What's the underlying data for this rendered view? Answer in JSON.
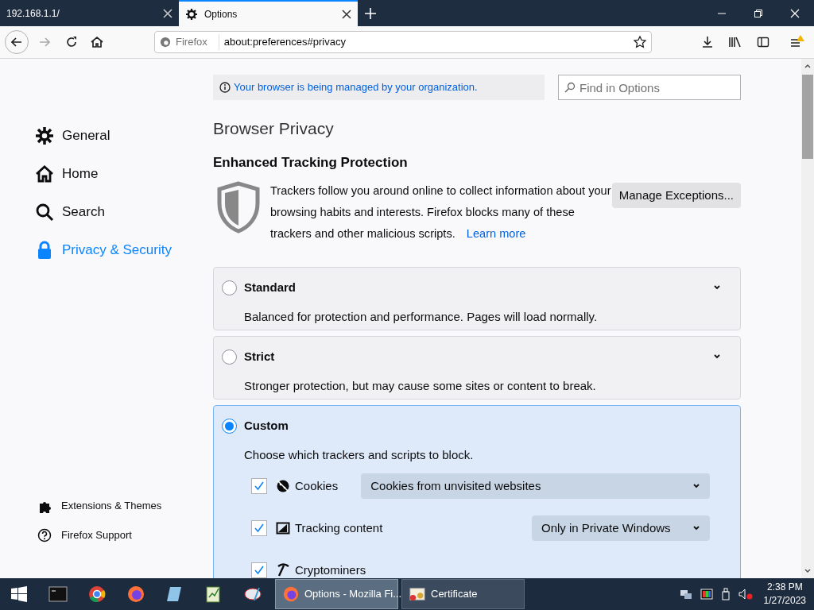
{
  "tabs": [
    {
      "label": "192.168.1.1/",
      "selected": false
    },
    {
      "label": "Options",
      "selected": true
    }
  ],
  "navbar": {
    "identity": "Firefox",
    "url": "about:preferences#privacy"
  },
  "sidebar": {
    "items": [
      {
        "label": "General",
        "selected": false
      },
      {
        "label": "Home",
        "selected": false
      },
      {
        "label": "Search",
        "selected": false
      },
      {
        "label": "Privacy & Security",
        "selected": true
      }
    ],
    "footer_links": [
      {
        "label": "Extensions & Themes"
      },
      {
        "label": "Firefox Support"
      }
    ]
  },
  "notice": "Your browser is being managed by your organization.",
  "search": {
    "placeholder": "Find in Options"
  },
  "section_title": "Browser Privacy",
  "etp": {
    "heading": "Enhanced Tracking Protection",
    "description": "Trackers follow you around online to collect information about your browsing habits and interests. Firefox blocks many of these trackers and other malicious scripts.",
    "link": "Learn more",
    "button": "Manage Exceptions..."
  },
  "options": [
    {
      "label": "Standard",
      "description": "Balanced for protection and performance. Pages will load normally.",
      "selected": false
    },
    {
      "label": "Strict",
      "description": "Stronger protection, but may cause some sites or content to break.",
      "selected": false
    },
    {
      "label": "Custom",
      "description": "Choose which trackers and scripts to block.",
      "selected": true
    }
  ],
  "custom_items": [
    {
      "label": "Cookies",
      "checked": true,
      "select": "Cookies from unvisited websites"
    },
    {
      "label": "Tracking content",
      "checked": true,
      "select": "Only in Private Windows"
    },
    {
      "label": "Cryptominers",
      "checked": true
    }
  ],
  "taskbar": {
    "tasks": [
      {
        "label": "Options - Mozilla Fi...",
        "selected": true
      },
      {
        "label": "Certificate",
        "selected": false
      }
    ],
    "time": "2:38 PM",
    "date": "1/27/2023"
  }
}
